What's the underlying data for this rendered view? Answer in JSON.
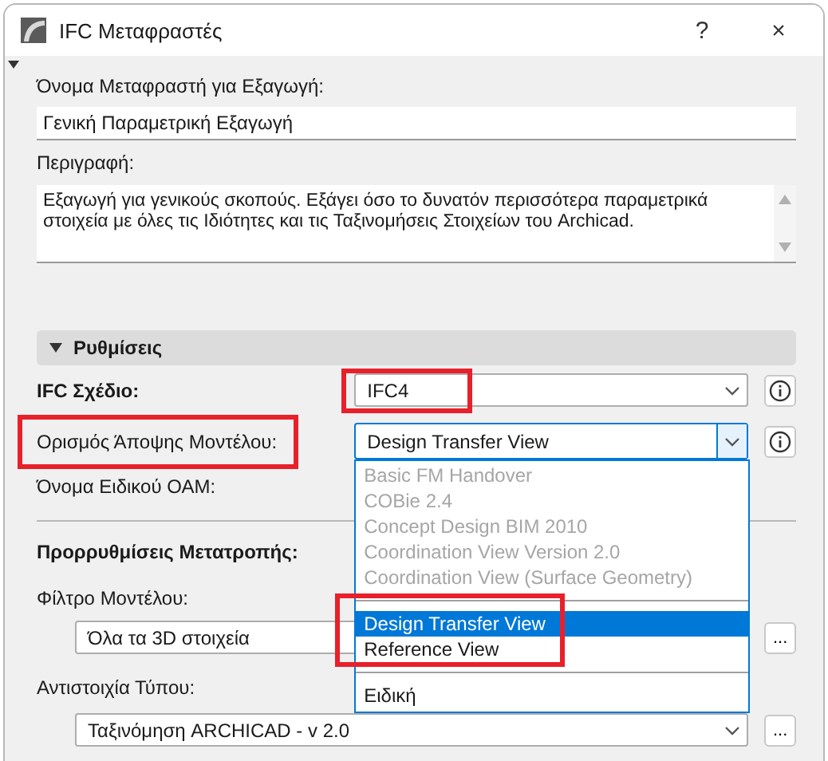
{
  "window": {
    "title": "IFC Μεταφραστές",
    "buttons": [
      "?",
      "×"
    ]
  },
  "name_field": {
    "label": "Όνομα Μεταφραστή για Εξαγωγή:",
    "value": "Γενική Παραμετρική Εξαγωγή"
  },
  "description": {
    "label": "Περιγραφή:",
    "value": "Εξαγωγή για γενικούς σκοπούς. Εξάγει όσο το δυνατόν περισσότερα παραμετρικά στοιχεία με όλες τις Ιδιότητες και τις Ταξινομήσεις Στοιχείων του Archicad."
  },
  "section": {
    "title": "Ρυθμίσεις",
    "expanded": true
  },
  "settings": [
    {
      "kind": "select",
      "label": "IFC Σχέδιο:",
      "bold": true,
      "value": "IFC4",
      "open": false,
      "label_highlighted": false,
      "value_highlighted": true
    },
    {
      "kind": "select",
      "label": "Ορισμός Άποψης Μοντέλου:",
      "bold": false,
      "value": "Design Transfer View",
      "open": true,
      "label_highlighted": true,
      "value_highlighted": false
    },
    {
      "kind": "text",
      "label": "Όνομα Ειδικού ΟΑΜ:",
      "bold": false,
      "label_highlighted": false
    }
  ],
  "dropdown": {
    "groups": [
      {
        "highlighted": false,
        "items": [
          {
            "label": "Basic FM Handover",
            "disabled": true,
            "selected": false
          },
          {
            "label": "COBie 2.4",
            "disabled": true,
            "selected": false
          },
          {
            "label": "Concept Design BIM 2010",
            "disabled": true,
            "selected": false
          },
          {
            "label": "Coordination View Version 2.0",
            "disabled": true,
            "selected": false
          },
          {
            "label": "Coordination View (Surface Geometry)",
            "disabled": true,
            "selected": false
          }
        ]
      },
      {
        "highlighted": true,
        "items": [
          {
            "label": "Design Transfer View",
            "disabled": false,
            "selected": true
          },
          {
            "label": "Reference View",
            "disabled": false,
            "selected": false
          }
        ]
      },
      {
        "highlighted": false,
        "items": [
          {
            "label": "Ειδική",
            "disabled": false,
            "selected": false
          }
        ]
      }
    ]
  },
  "presets": {
    "title": "Προρρυθμίσεις Μετατροπής:",
    "rows": [
      {
        "label": "Φίλτρο Μοντέλου:",
        "value": "Όλα τα 3D στοιχεία",
        "button": "..."
      },
      {
        "label": "Αντιστοιχία Τύπου:",
        "value": "Ταξινόμηση ARCHICAD - v 2.0",
        "button": "..."
      }
    ]
  }
}
